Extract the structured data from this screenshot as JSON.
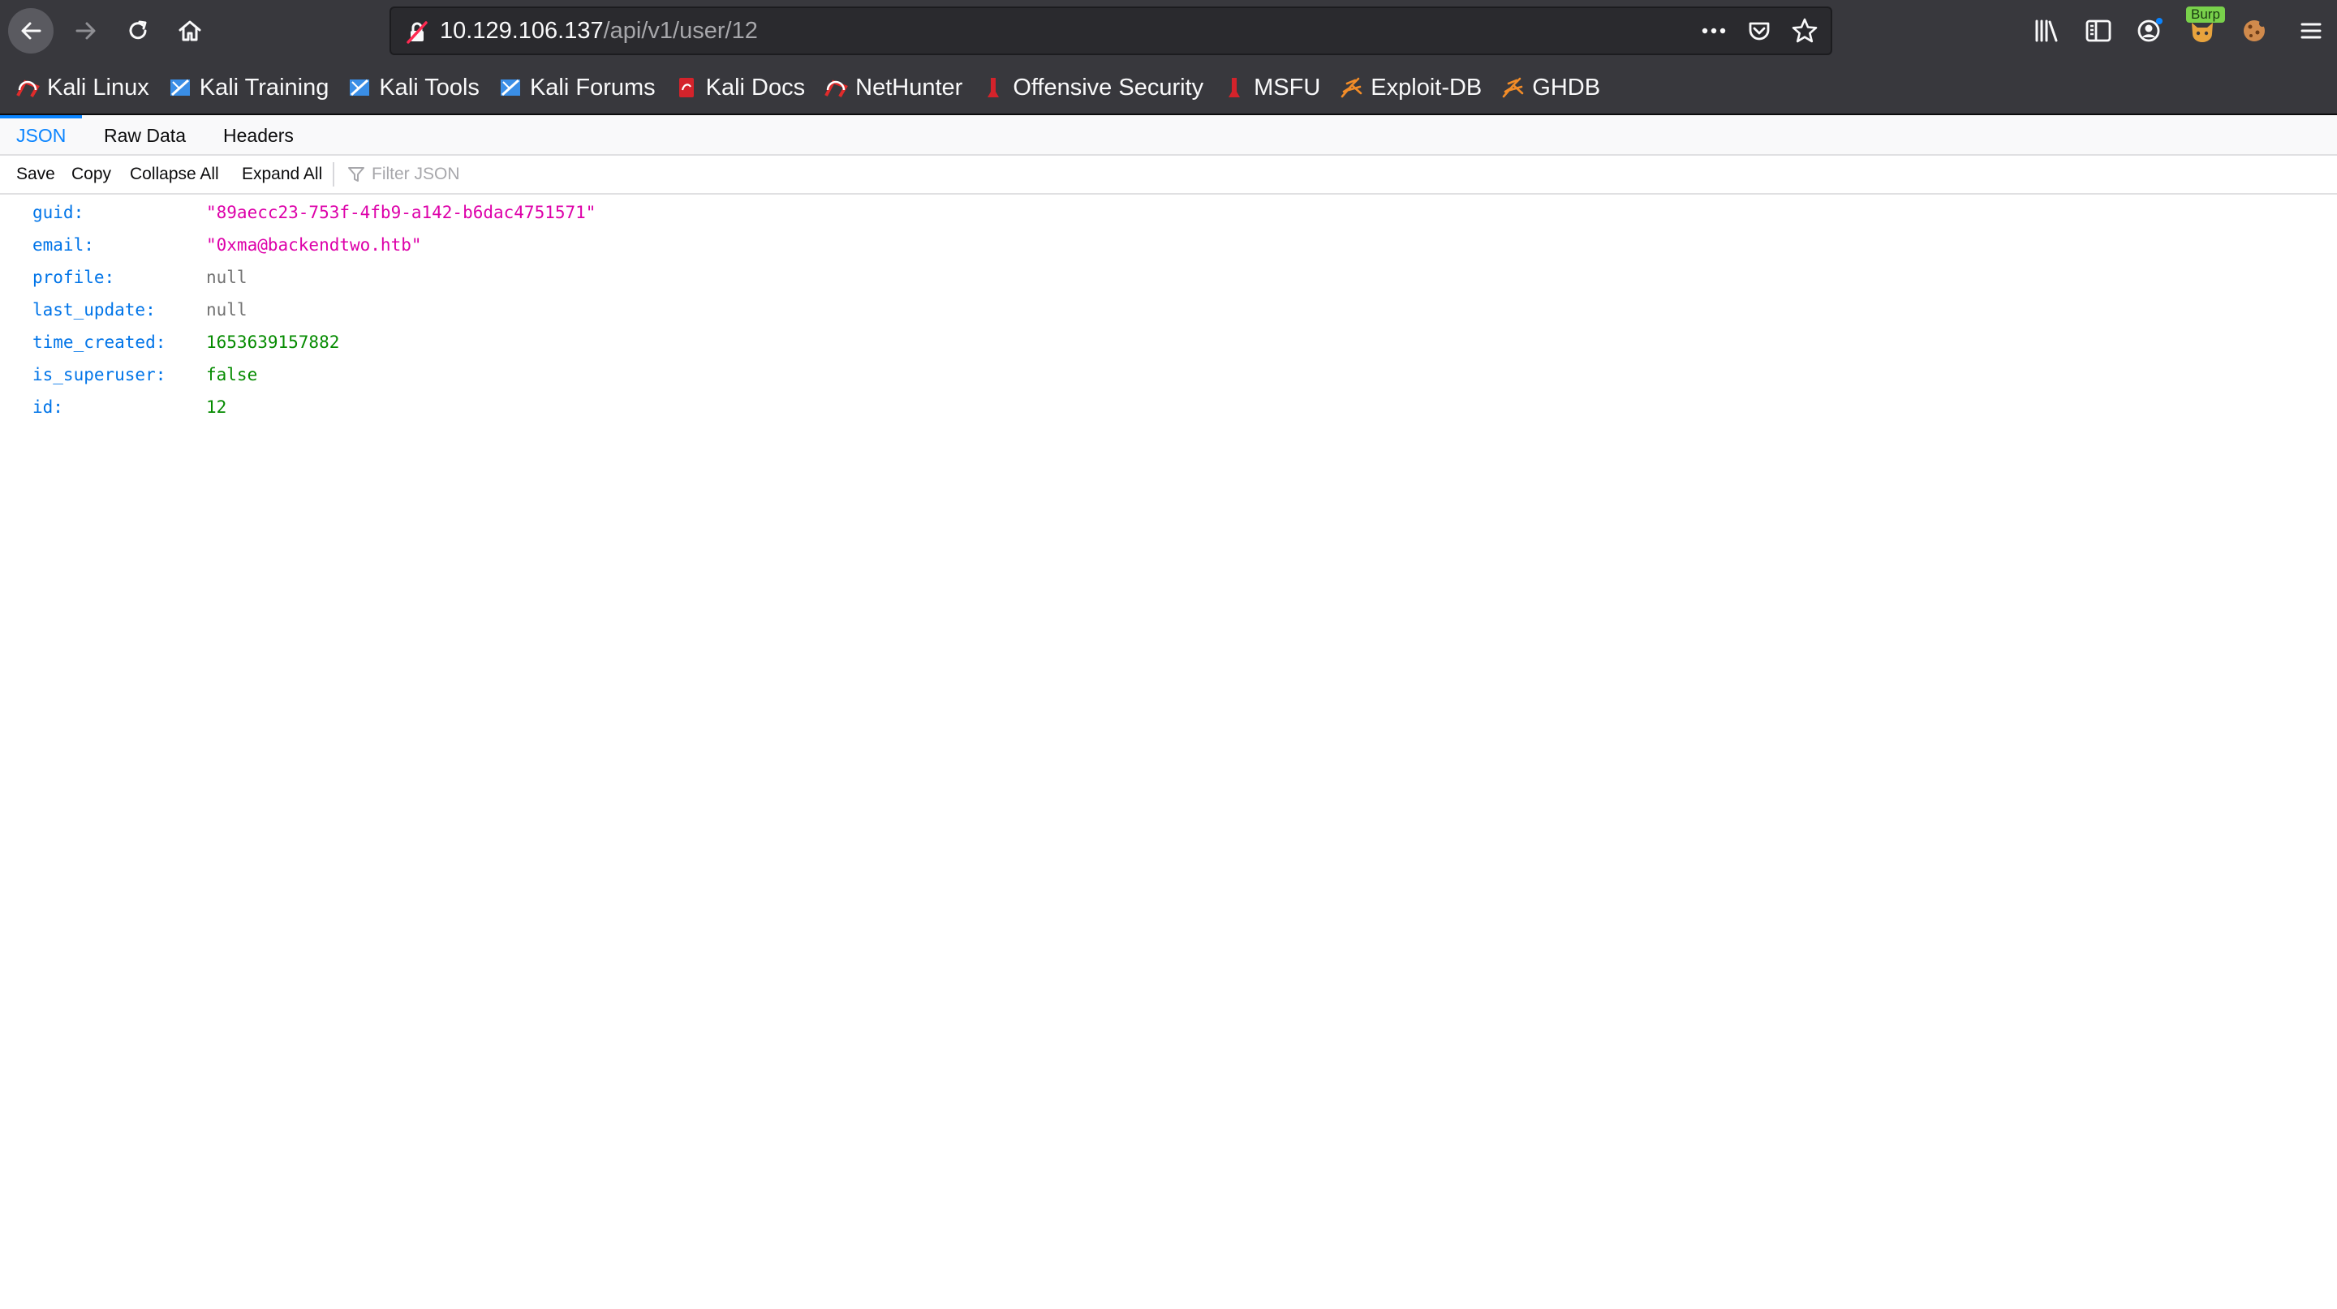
{
  "browser": {
    "url_host": "10.129.106.137",
    "url_path": "/api/v1/user/12",
    "burp_badge": "Burp"
  },
  "bookmarks": [
    {
      "label": "Kali Linux",
      "icon": "kali-dragon-icon"
    },
    {
      "label": "Kali Training",
      "icon": "kali-training-icon"
    },
    {
      "label": "Kali Tools",
      "icon": "kali-tools-icon"
    },
    {
      "label": "Kali Forums",
      "icon": "kali-forums-icon"
    },
    {
      "label": "Kali Docs",
      "icon": "kali-docs-icon"
    },
    {
      "label": "NetHunter",
      "icon": "nethunter-icon"
    },
    {
      "label": "Offensive Security",
      "icon": "offsec-icon"
    },
    {
      "label": "MSFU",
      "icon": "msfu-icon"
    },
    {
      "label": "Exploit-DB",
      "icon": "exploitdb-icon"
    },
    {
      "label": "GHDB",
      "icon": "ghdb-icon"
    }
  ],
  "viewer": {
    "tabs": [
      "JSON",
      "Raw Data",
      "Headers"
    ],
    "active_tab": "JSON",
    "buttons": [
      "Save",
      "Copy",
      "Collapse All",
      "Expand All"
    ],
    "filter_placeholder": "Filter JSON"
  },
  "json_rows": [
    {
      "key": "guid:",
      "value": "\"89aecc23-753f-4fb9-a142-b6dac4751571\"",
      "type": "string"
    },
    {
      "key": "email:",
      "value": "\"0xma@backendtwo.htb\"",
      "type": "string"
    },
    {
      "key": "profile:",
      "value": "null",
      "type": "null"
    },
    {
      "key": "last_update:",
      "value": "null",
      "type": "null"
    },
    {
      "key": "time_created:",
      "value": "1653639157882",
      "type": "number"
    },
    {
      "key": "is_superuser:",
      "value": "false",
      "type": "bool"
    },
    {
      "key": "id:",
      "value": "12",
      "type": "number"
    }
  ],
  "colors": {
    "chrome_bg": "#38383d",
    "urlbar_bg": "#2a2a2e",
    "accent_blue": "#0a84ff",
    "json_key": "#0074e8",
    "json_string": "#dd00a9",
    "json_number": "#058b00",
    "json_null": "#737373"
  }
}
